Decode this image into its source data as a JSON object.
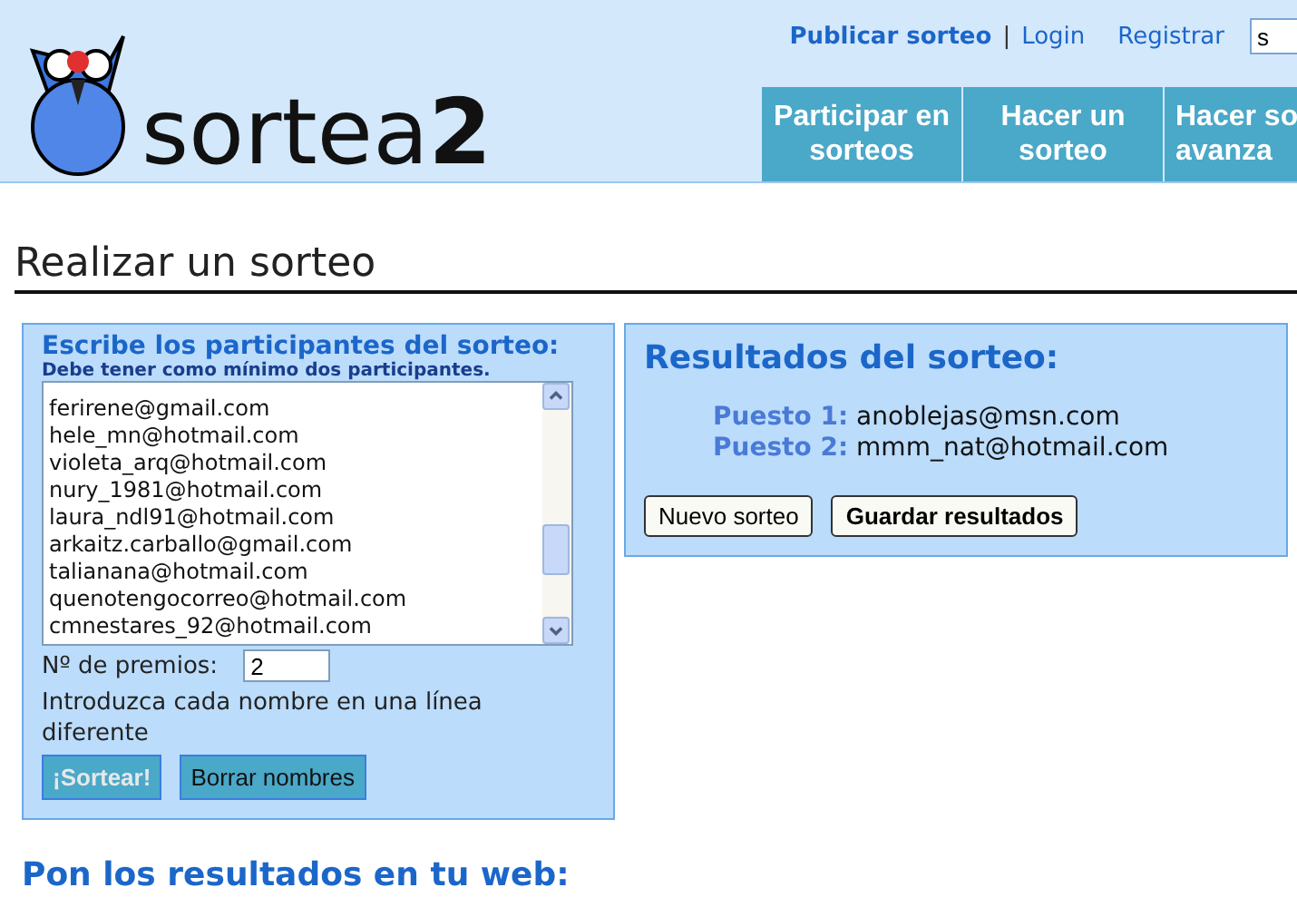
{
  "header": {
    "logo_text": "sortea",
    "logo_bold": "2",
    "links": [
      {
        "label": "Publicar sorteo",
        "bold": true
      },
      {
        "label": "Login",
        "bold": false,
        "separator": "|"
      },
      {
        "label": "Registrar",
        "bold": false
      }
    ],
    "search": {
      "value": "s"
    },
    "tabs": [
      {
        "lines": [
          "Participar en",
          "sorteos"
        ]
      },
      {
        "lines": [
          "Hacer un",
          "sorteo"
        ]
      },
      {
        "lines": [
          "Hacer so",
          "avanza"
        ]
      }
    ]
  },
  "page_title": "Realizar un sorteo",
  "participants": {
    "title": "Escribe los participantes del sorteo:",
    "hint": "Debe tener como mínimo dos participantes.",
    "entries": [
      "ferirene@gmail.com",
      "hele_mn@hotmail.com",
      "violeta_arq@hotmail.com",
      "nury_1981@hotmail.com",
      "laura_ndl91@hotmail.com",
      "arkaitz.carballo@gmail.com",
      "talianana@hotmail.com",
      "quenotengocorreo@hotmail.com",
      "cmnestares_92@hotmail.com"
    ],
    "prizes_label": "Nº de premios:",
    "prizes_value": "2",
    "instruction": "Introduzca cada nombre en una línea diferente",
    "buttons": [
      {
        "label": "¡Sortear!",
        "disabled": true
      },
      {
        "label": "Borrar nombres",
        "disabled": false
      }
    ]
  },
  "results": {
    "title": "Resultados del sorteo:",
    "places": [
      {
        "label": "Puesto 1:",
        "value": "anoblejas@msn.com"
      },
      {
        "label": "Puesto 2:",
        "value": "mmm_nat@hotmail.com"
      }
    ],
    "buttons": [
      {
        "label": "Nuevo sorteo",
        "bold": false
      },
      {
        "label": "Guardar resultados",
        "bold": true
      }
    ]
  },
  "embed_title": "Pon los resultados en tu web:"
}
